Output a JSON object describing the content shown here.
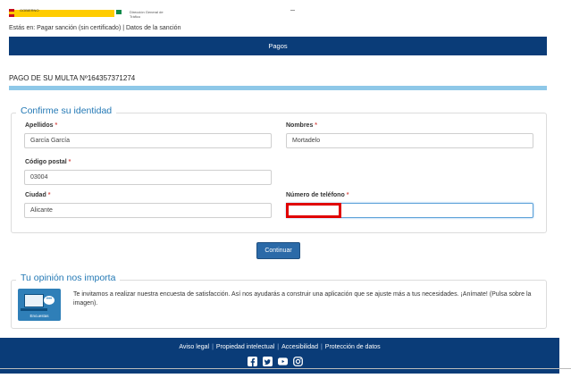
{
  "header": {
    "logo_text": "GOBIERNO",
    "sub_brand": "Dirección General de Tráfico",
    "breadcrumb": "Estás en: Pagar sanción (sin certificado) | Datos de la sanción"
  },
  "section_bar": {
    "title": "Pagos"
  },
  "multa": {
    "title": "PAGO DE SU MULTA Nº164357371274"
  },
  "identity": {
    "legend": "Confirme su identidad",
    "apellidos": {
      "label": "Apellidos",
      "value": "García García"
    },
    "nombres": {
      "label": "Nombres",
      "value": "Mortadelo"
    },
    "codigo_postal": {
      "label": "Código postal",
      "value": "03004"
    },
    "ciudad": {
      "label": "Ciudad",
      "value": "Alicante"
    },
    "telefono": {
      "label": "Número de teléfono",
      "value": ""
    },
    "required_mark": "*"
  },
  "actions": {
    "continuar": "Continuar"
  },
  "opinion": {
    "legend": "Tu opinión nos importa",
    "text": "Te invitamos a realizar nuestra encuesta de satisfacción. Así nos ayudarás a construir una aplicación que se ajuste más a tus necesidades. ¡Anímate! (Pulsa sobre la imagen).",
    "image_label": "Encuestas"
  },
  "footer": {
    "links": [
      "Aviso legal",
      "Propiedad intelectual",
      "Accesibilidad",
      "Protección de datos"
    ],
    "social_icons": [
      "facebook-icon",
      "twitter-icon",
      "youtube-icon",
      "instagram-icon"
    ]
  },
  "colors": {
    "brand_dark_blue": "#0a3c78",
    "legend_blue": "#2479b5",
    "light_blue_rule": "#8ec8e8",
    "button_blue": "#2b6aa8",
    "highlight_red": "#e00000"
  }
}
